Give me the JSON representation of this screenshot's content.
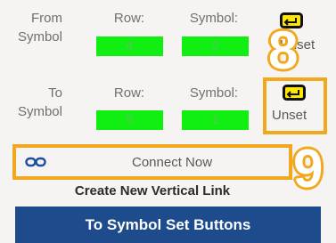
{
  "from": {
    "label_line1": "From",
    "label_line2": "Symbol",
    "row_label": "Row:",
    "symbol_label": "Symbol:",
    "row_value": "4",
    "symbol_value": "2",
    "set_button_label": "Unset"
  },
  "to": {
    "label_line1": "To",
    "label_line2": "Symbol",
    "row_label": "Row:",
    "symbol_label": "Symbol:",
    "row_value": "5",
    "symbol_value": "1",
    "set_button_label": "Unset"
  },
  "connect_button_label": "Connect Now",
  "link_section_title": "Create New Vertical Link",
  "callouts": [
    "8",
    "9"
  ],
  "caption": "To Symbol Set Buttons",
  "colors": {
    "field": "#11ee11",
    "callout": "#f2a81d",
    "caption_bg": "#1e4b8c"
  },
  "icons": {
    "set_button": "return-key-icon",
    "connect_button": "link-icon"
  }
}
